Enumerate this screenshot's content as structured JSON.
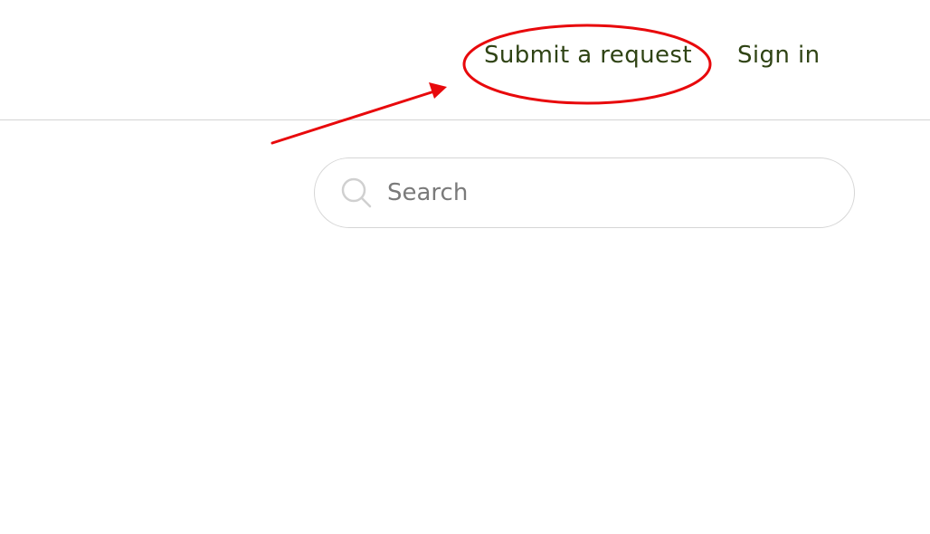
{
  "header": {
    "submit_request_label": "Submit a request",
    "sign_in_label": "Sign in"
  },
  "search": {
    "placeholder": "Search",
    "value": "",
    "icon": "search-icon"
  },
  "annotation": {
    "color": "#e8090c",
    "highlight": "ellipse-around-submit-request",
    "pointer": "arrow-pointing-to-submit-request"
  },
  "colors": {
    "link": "#2f4314",
    "divider": "#d4d4d4",
    "search_border": "#d6d6d6",
    "placeholder": "#7a7a7a"
  }
}
